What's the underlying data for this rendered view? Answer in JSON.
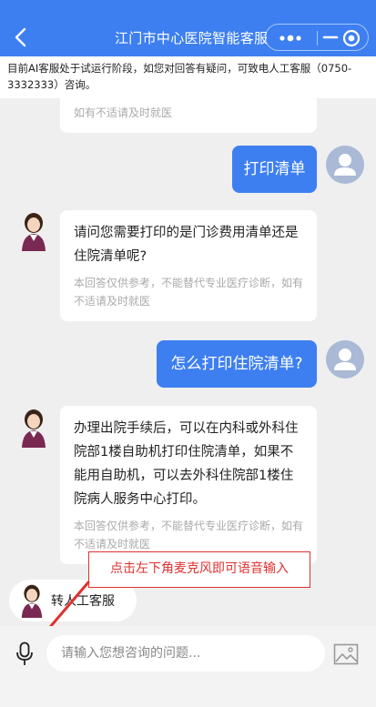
{
  "header": {
    "title": "江门市中心医院智能客服",
    "icons": [
      "back-icon",
      "more-icon",
      "minimize-icon",
      "close-icon"
    ]
  },
  "notice": "目前AI客服处于试运行阶段，如您对回答有疑问，可致电人工客服（0750-3332333）咨询。",
  "messages": [
    {
      "from": "bot",
      "disclaimer": "如有不适请及时就医"
    },
    {
      "from": "user",
      "text": "打印清单"
    },
    {
      "from": "bot",
      "text": "请问您需要打印的是门诊费用清单还是住院清单呢?",
      "disclaimer": "本回答仅供参考，不能替代专业医疗诊断，如有不适请及时就医"
    },
    {
      "from": "user",
      "text": "怎么打印住院清单?"
    },
    {
      "from": "bot",
      "text": "办理出院手续后，可以在内科或外科住院部1楼自助机打印住院清单，如果不能用自助机，可以去外科住院部1楼住院病人服务中心打印。",
      "disclaimer": "本回答仅供参考，不能替代专业医疗诊断，如有不适请及时就医"
    }
  ],
  "annotation": "点击左下角麦克风即可语音输入",
  "transfer_button": "转人工客服",
  "input": {
    "placeholder": "请输入您想咨询的问题..."
  },
  "colors": {
    "accent": "#3d7ff0",
    "annotation": "#e03030",
    "background": "#efefef"
  }
}
